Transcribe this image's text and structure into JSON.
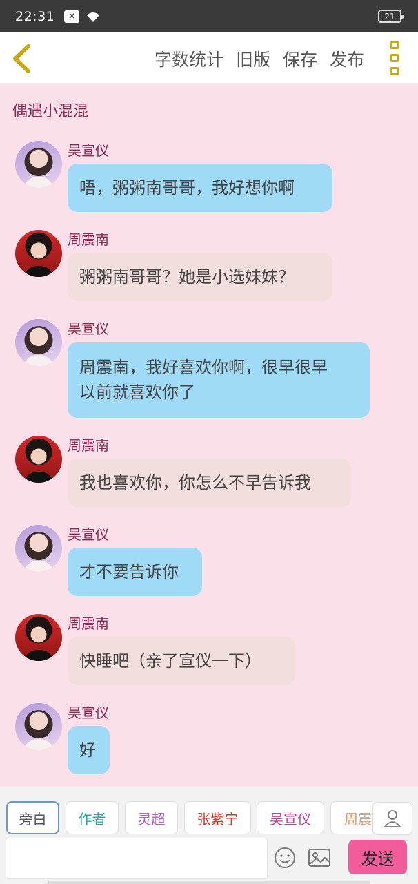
{
  "status_bar": {
    "time": "22:31",
    "notification_badge": "×",
    "battery": "21"
  },
  "toolbar": {
    "word_count": "字数统计",
    "old_version": "旧版",
    "save": "保存",
    "publish": "发布"
  },
  "chat": {
    "title": "偶遇小混混",
    "messages": [
      {
        "sender": "吴宣仪",
        "text": "唔，粥粥南哥哥，我好想你啊",
        "style": "blue",
        "avatar": "girl-avatar"
      },
      {
        "sender": "周震南",
        "text": "粥粥南哥哥？她是小选妹妹？",
        "style": "grey",
        "avatar": "boy-avatar"
      },
      {
        "sender": "吴宣仪",
        "text": "周震南，我好喜欢你啊，很早很早",
        "text2": "以前就喜欢你了",
        "style": "blue",
        "avatar": "girl-avatar"
      },
      {
        "sender": "周震南",
        "text": "我也喜欢你，你怎么不早告诉我",
        "style": "grey",
        "avatar": "boy-avatar"
      },
      {
        "sender": "吴宣仪",
        "text": "才不要告诉你",
        "style": "blue",
        "avatar": "girl-avatar"
      },
      {
        "sender": "周震南",
        "text": "快睡吧（亲了宣仪一下）",
        "style": "grey",
        "avatar": "boy-avatar"
      },
      {
        "sender": "吴宣仪",
        "text": "好",
        "style": "blue",
        "avatar": "girl-avatar"
      }
    ]
  },
  "roles": [
    {
      "label": "旁白",
      "color": "#555555"
    },
    {
      "label": "作者",
      "color": "#2aa8a0"
    },
    {
      "label": "灵超",
      "color": "#b45ec7"
    },
    {
      "label": "张紫宁",
      "color": "#d0362a"
    },
    {
      "label": "吴宣仪",
      "color": "#c23e8f"
    },
    {
      "label": "周震",
      "color": "#e89b6c"
    }
  ],
  "composer": {
    "placeholder": "",
    "send_label": "发送"
  },
  "icons": {
    "back": "chevron-left-icon",
    "menu": "more-vertical-icon",
    "emoji": "smile-icon",
    "image": "image-icon",
    "contact": "user-icon"
  },
  "colors": {
    "accent": "#c9a814",
    "send": "#f25c9a",
    "chat_bg": "#fbe0ea"
  }
}
